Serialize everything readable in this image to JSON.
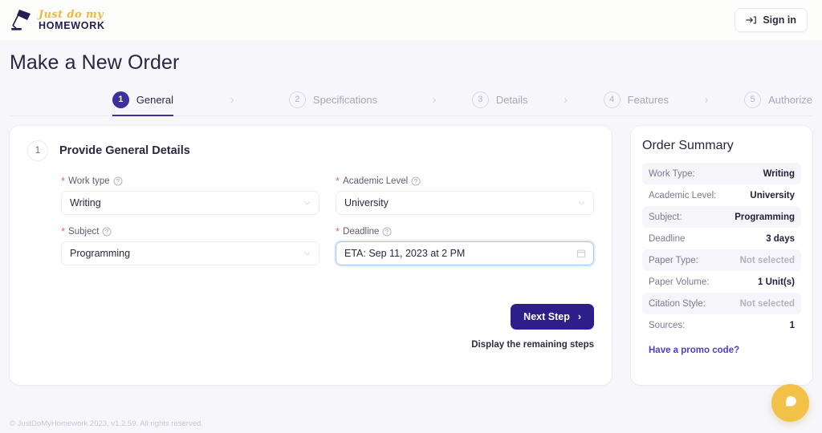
{
  "header": {
    "logo": {
      "script": "Just do my",
      "word": "HOMEWORK",
      "icon": "desk-lamp-icon"
    },
    "signin_label": "Sign in",
    "signin_icon": "sign-in-arrow-icon"
  },
  "page_title": "Make a New Order",
  "steps": [
    {
      "num": "1",
      "label": "General",
      "state": "active"
    },
    {
      "num": "2",
      "label": "Specifications",
      "state": "idle"
    },
    {
      "num": "3",
      "label": "Details",
      "state": "idle"
    },
    {
      "num": "4",
      "label": "Features",
      "state": "idle"
    },
    {
      "num": "5",
      "label": "Authorize",
      "state": "idle"
    }
  ],
  "step_separator": "›",
  "form": {
    "step_number": "1",
    "heading": "Provide General Details",
    "fields": {
      "work_type": {
        "label": "Work type",
        "value": "Writing"
      },
      "academic_level": {
        "label": "Academic Level",
        "value": "University"
      },
      "subject": {
        "label": "Subject",
        "value": "Programming"
      },
      "deadline": {
        "label": "Deadline",
        "value": "ETA: Sep 11, 2023 at 2 PM"
      }
    },
    "next_label": "Next Step",
    "next_chevron": "›",
    "hint": "Display the remaining steps"
  },
  "summary": {
    "title": "Order Summary",
    "rows": [
      {
        "key": "Work Type:",
        "value": "Writing",
        "muted": false,
        "shade": true
      },
      {
        "key": "Academic Level:",
        "value": "University",
        "muted": false,
        "shade": false
      },
      {
        "key": "Subject:",
        "value": "Programming",
        "muted": false,
        "shade": true
      },
      {
        "key": "Deadline",
        "value": "3 days",
        "muted": false,
        "shade": false
      },
      {
        "key": "Paper Type:",
        "value": "Not selected",
        "muted": true,
        "shade": true
      },
      {
        "key": "Paper Volume:",
        "value": "1 Unit(s)",
        "muted": false,
        "shade": false
      },
      {
        "key": "Citation Style:",
        "value": "Not selected",
        "muted": true,
        "shade": true
      },
      {
        "key": "Sources:",
        "value": "1",
        "muted": false,
        "shade": false
      }
    ],
    "promo_label": "Have a promo code?"
  },
  "footer": {
    "text": "© JustDoMyHomework 2023, v1.2.59. All rights reserved."
  },
  "chat": {
    "icon": "chat-bubble-icon"
  },
  "colors": {
    "accent_purple": "#3c2f9e",
    "button_purple": "#2d1e8c",
    "brand_gold": "#f0b73f",
    "brand_navy": "#241c52",
    "required_red": "#ef5f6b",
    "focus_blue": "#9ec5f5",
    "page_bg": "#f7f7fb",
    "chat_yellow": "#f2c248"
  }
}
